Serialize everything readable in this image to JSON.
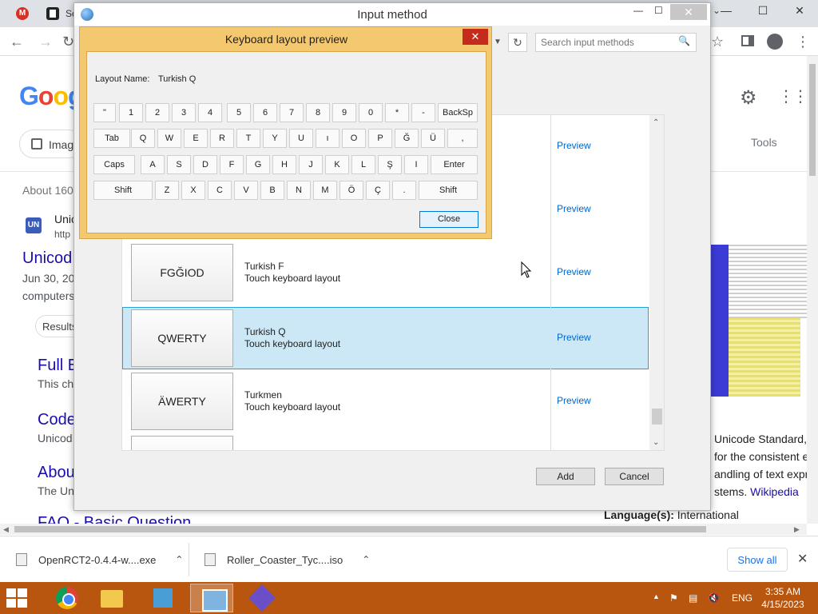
{
  "browser": {
    "tab_text": "Sc",
    "tab_favicon_letter": "M",
    "search_placeholder": "Search input methods",
    "google_logo": [
      "G",
      "o",
      "o",
      "g"
    ],
    "images_chip": "Imag",
    "tools": "Tools",
    "about_results": "About 160",
    "result1_site": "Unic",
    "result1_url": "http",
    "result1_title": "Unicod",
    "result1_date": "Jun 30, 20",
    "result1_snip": "computers",
    "results_chip": "Results",
    "result2_title": "Full E",
    "result2_snip": "This ch",
    "result3_title": "Code",
    "result3_snip": "Unicod",
    "result4_title": "Abou",
    "result4_snip": "The Un",
    "result5_title": "FAQ - Basic Question",
    "kp_line1": "Unicode Standard,",
    "kp_line2": "for the consistent e",
    "kp_line3": "andling of text expr",
    "kp_line4_a": "stems. ",
    "kp_line4_link": "Wikipedia",
    "kp_lang_label": "Language(s):",
    "kp_lang_value": " International",
    "favicon_un": "UN"
  },
  "downloads": {
    "item1": "OpenRCT2-0.4.4-w....exe",
    "item2": "Roller_Coaster_Tyc....iso",
    "show_all": "Show all"
  },
  "taskbar": {
    "lang": "ENG",
    "time": "3:35 AM",
    "date": "4/15/2023"
  },
  "input_method": {
    "title": "Input method",
    "search_placeholder": "Search input methods",
    "rows": [
      {
        "key": "",
        "name": "",
        "desc": "",
        "link": "Preview"
      },
      {
        "key": "",
        "name": "",
        "desc": "",
        "link": "Preview"
      },
      {
        "key": "FGĞIOD",
        "name": "Turkish F",
        "desc": "Touch keyboard layout",
        "link": "Preview"
      },
      {
        "key": "QWERTY",
        "name": "Turkish Q",
        "desc": "Touch keyboard layout",
        "link": "Preview"
      },
      {
        "key": "ÄWERTY",
        "name": "Turkmen",
        "desc": "Touch keyboard layout",
        "link": "Preview"
      }
    ],
    "add_label": "Add",
    "cancel_label": "Cancel"
  },
  "keyboard_preview": {
    "title": "Keyboard layout preview",
    "layout_label": "Layout Name:",
    "layout_value": "Turkish Q",
    "row1": [
      "\"",
      "1",
      "2",
      "3",
      "4",
      "5",
      "6",
      "7",
      "8",
      "9",
      "0",
      "*",
      "-",
      "BackSp"
    ],
    "row2": [
      "Tab",
      "Q",
      "W",
      "E",
      "R",
      "T",
      "Y",
      "U",
      "ı",
      "O",
      "P",
      "Ğ",
      "Ü",
      ","
    ],
    "row3": [
      "Caps",
      "A",
      "S",
      "D",
      "F",
      "G",
      "H",
      "J",
      "K",
      "L",
      "Ş",
      "I",
      "Enter"
    ],
    "row4": [
      "Shift",
      "Z",
      "X",
      "C",
      "V",
      "B",
      "N",
      "M",
      "Ö",
      "Ç",
      ".",
      "Shift"
    ],
    "close_label": "Close"
  },
  "icons": {
    "close": "✕",
    "minimize": "—",
    "maximize": "☐",
    "back": "←",
    "forward": "→",
    "reload": "↻",
    "star": "☆",
    "menu": "⋮",
    "settings": "⚙",
    "apps": "⋮⋮⋮",
    "search": "🔍",
    "chevron_up": "▲",
    "chevron_down": "▼",
    "chevron_left": "◀",
    "chevron_right": "▶",
    "chevron": "⌃",
    "chevron_down_small": "⌄"
  }
}
